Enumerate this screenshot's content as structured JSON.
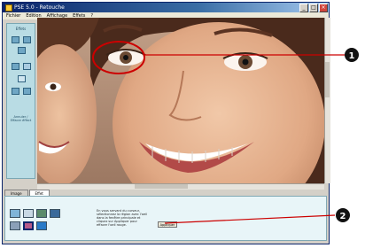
{
  "window": {
    "title": "PSE 5.0 - Retouche",
    "buttons": [
      "_",
      "□",
      "×"
    ]
  },
  "menu": {
    "items": [
      "Fichier",
      "Edition",
      "Affichage",
      "Effets",
      "?"
    ]
  },
  "left_panel": {
    "label": "Effets",
    "caption": "Annuler / Effacer éffect"
  },
  "tabs": [
    "Image",
    "Effet"
  ],
  "bottom_panel": {
    "description": "En vous servant du curseur, sélectionnez la région avec l'oeil dans la fenêtre principale et cliquez sur Appliquer pour effacer l'oeil rouge.",
    "apply_label": "Appliquer"
  },
  "callouts": [
    {
      "number": "1"
    },
    {
      "number": "2"
    }
  ],
  "colors": {
    "callout_red": "#cc0000",
    "title_blue": "#0a246a",
    "panel_teal": "#b9dce4"
  }
}
